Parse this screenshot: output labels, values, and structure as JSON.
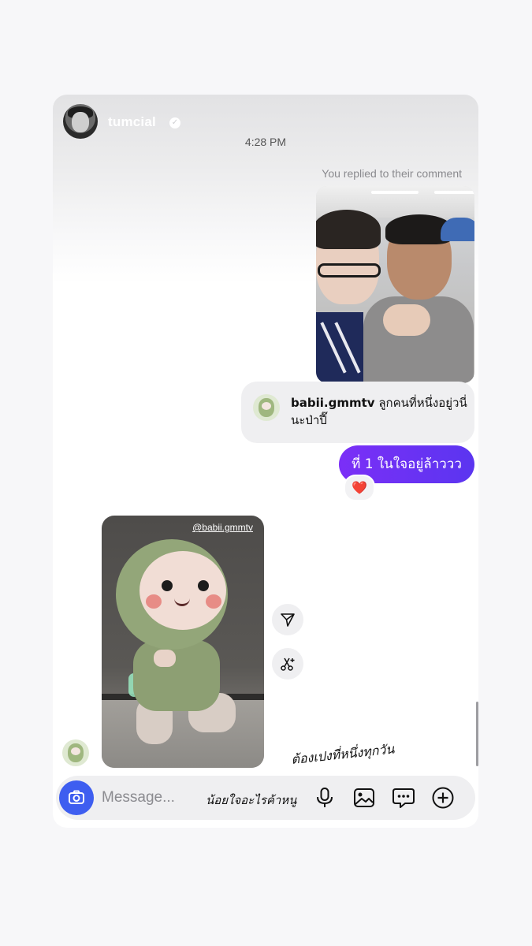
{
  "header": {
    "username": "tumcial",
    "verified_icon": "verified-badge-icon",
    "time": "4:28 PM"
  },
  "thread": {
    "replied_label": "You replied to their comment",
    "quoted_comment": {
      "user": "babii.gmmtv",
      "text": "ลูกคนที่หนึ่งอยู่วนี่นะป่าปี๊"
    },
    "sent_message": "ที่ 1 ในใจอยู่ล้าววว",
    "reaction": "❤️",
    "shared_post_tag": "@babii.gmmtv",
    "actions": [
      "share-icon",
      "sparkle-scissors-icon"
    ]
  },
  "composer": {
    "placeholder": "Message...",
    "handwritten_1": "น้อยใจอะไรค้าหนู",
    "handwritten_2": "ต้องเปงที่หนึ่งทุกวัน",
    "icons": [
      "camera-icon",
      "microphone-icon",
      "gallery-icon",
      "sticker-icon",
      "plus-icon"
    ]
  },
  "colors": {
    "accent": "#6236f3",
    "camera": "#3e5ef0",
    "heart": "#ef2d3e"
  }
}
